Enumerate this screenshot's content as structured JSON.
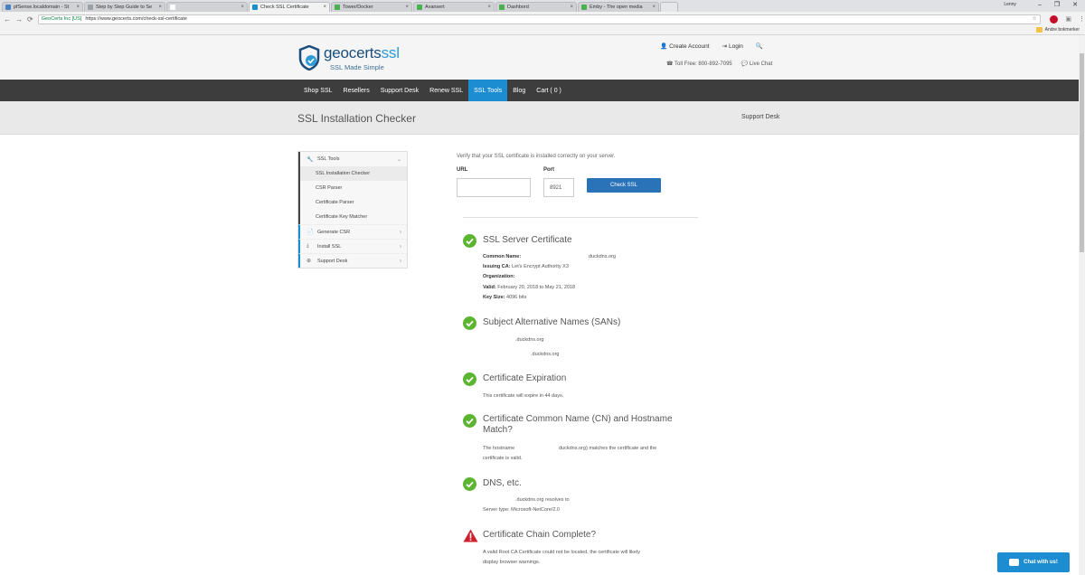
{
  "browser": {
    "tabs": [
      {
        "label": "pfSense.localdomain - St",
        "favicon_color": "#4a7fc1",
        "active": false
      },
      {
        "label": "Step by Step Guide to Se",
        "favicon_color": "#9aa0a6",
        "active": false
      },
      {
        "label": "",
        "favicon_color": "#ffffff",
        "active": false
      },
      {
        "label": "Check SSL Certificate",
        "favicon_color": "#1d8dd1",
        "active": true
      },
      {
        "label": "Tower/Docker",
        "favicon_color": "#4caf50",
        "active": false
      },
      {
        "label": "Avansert",
        "favicon_color": "#4caf50",
        "active": false
      },
      {
        "label": "Dashbord",
        "favicon_color": "#4caf50",
        "active": false
      },
      {
        "label": "Emby - The open media",
        "favicon_color": "#4caf50",
        "active": false
      }
    ],
    "close_glyph": "×",
    "window_user": "Lenny",
    "win_min": "–",
    "win_max": "❐",
    "win_close": "✕",
    "back": "←",
    "forward": "→",
    "reload": "⟳",
    "secure_label": "GeoCerts Inc [US]",
    "url": "https://www.geocerts.com/check-ssl-certificate",
    "star": "☆",
    "bookmarks_right": "Andre bokmerker"
  },
  "header": {
    "brand_main": "geocerts",
    "brand_ssl": "ssl",
    "tagline": "SSL Made Simple",
    "create_account": "Create Account",
    "login": "Login",
    "toll_free": "Toll Free: 800-892-7095",
    "live_chat": "Live Chat"
  },
  "nav": {
    "items": [
      "Shop SSL",
      "Resellers",
      "Support Desk",
      "Renew SSL",
      "SSL Tools",
      "Blog",
      "Cart ( 0 )"
    ],
    "active_index": 4
  },
  "title_bar": {
    "title": "SSL Installation Checker",
    "support": "Support Desk"
  },
  "sidebar": {
    "tools_label": "SSL Tools",
    "sub_items": [
      "SSL Installation Checker",
      "CSR Parser",
      "Certificate Parser",
      "Certificate Key Matcher"
    ],
    "groups": [
      "Generate CSR",
      "Install SSL",
      "Support Desk"
    ]
  },
  "form": {
    "intro": "Verify that your SSL certificate is installed correctly on your server.",
    "url_label": "URL",
    "url_value": "",
    "port_label": "Port",
    "port_value": "8921",
    "button": "Check SSL"
  },
  "results": {
    "server_cert": {
      "title": "SSL Server Certificate",
      "common_name_label": "Common Name:",
      "common_name": "duckdns.org",
      "issuing_ca_label": "Issuing CA:",
      "issuing_ca": "Let's Encrypt Authority X3",
      "organization_label": "Organization:",
      "valid_label": "Valid:",
      "valid": "February 20, 2018 to May 21, 2018",
      "key_size_label": "Key Size:",
      "key_size": "4096 bits"
    },
    "sans": {
      "title": "Subject Alternative Names (SANs)",
      "entries": [
        ".duckdns.org",
        ".duckdns.org"
      ]
    },
    "expiration": {
      "title": "Certificate Expiration",
      "text": "This certificate will expire in 44 days."
    },
    "hostname": {
      "title": "Certificate Common Name (CN) and Hostname Match?",
      "text_a": "The hostname",
      "text_b": "duckdns.org) matches the certificate and the",
      "text_c": "certificate is valid."
    },
    "dns": {
      "title": "DNS, etc.",
      "resolve": ".duckdns.org resolves to",
      "server_type": "Server type: Microsoft-NetCore/2.0"
    },
    "chain": {
      "title": "Certificate Chain Complete?",
      "line1": "A valid Root CA Certificate could not be located, the certificate will likely",
      "line2": "display browser warnings."
    }
  },
  "chat_widget": {
    "label": "Chat with us!"
  },
  "colors": {
    "accent": "#1d8dd1",
    "success": "#5cb531",
    "warning": "#d0202c",
    "nav_bg": "#3d3d3d"
  }
}
